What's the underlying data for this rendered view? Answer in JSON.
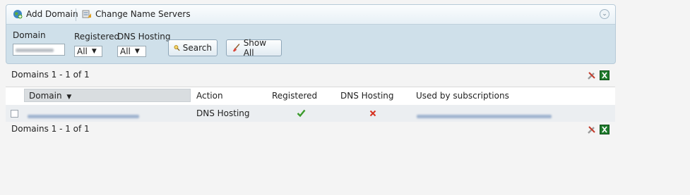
{
  "toolbar": {
    "add_domain": "Add Domain",
    "change_name_servers": "Change Name Servers"
  },
  "filters": {
    "domain_label": "Domain",
    "registered_label": "Registered",
    "registered_value": "All",
    "dns_hosting_label": "DNS Hosting",
    "dns_hosting_value": "All",
    "search_button": "Search",
    "show_all_button": "Show All"
  },
  "pagination": {
    "top": "Domains 1 - 1 of 1",
    "bottom": "Domains 1 - 1 of 1"
  },
  "table": {
    "columns": {
      "domain": "Domain",
      "action": "Action",
      "registered": "Registered",
      "dns_hosting": "DNS Hosting",
      "used_by": "Used by subscriptions"
    },
    "rows": [
      {
        "action": "DNS Hosting",
        "registered_icon": "check-icon",
        "dns_hosting_icon": "cross-icon"
      }
    ]
  },
  "colors": {
    "panel_bg": "#cfe0ea",
    "check": "#3a9a2a",
    "cross": "#d6301f",
    "excel": "#1e7a2c"
  }
}
